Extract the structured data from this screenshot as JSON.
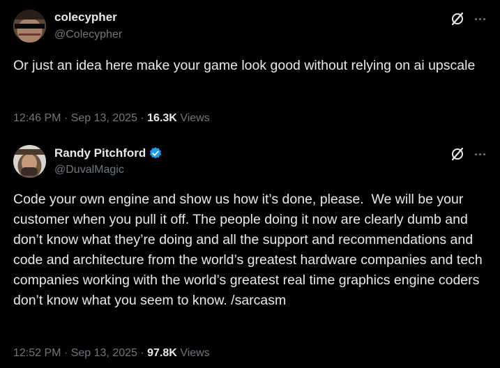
{
  "tweets": [
    {
      "author": {
        "display_name": "colecypher",
        "handle": "@Colecypher",
        "verified": false
      },
      "text": "Or just an idea here make your game look good without relying on ai upscale",
      "time": "12:46 PM",
      "date": "Sep 13, 2025",
      "separator": "·",
      "views_count": "16.3K",
      "views_label": "Views"
    },
    {
      "author": {
        "display_name": "Randy Pitchford",
        "handle": "@DuvalMagic",
        "verified": true
      },
      "text": "Code your own engine and show us how it’s done, please.  We will be your customer when you pull it off. The people doing it now are clearly dumb and don’t know what they’re doing and all the support and recommendations and code and architecture from the world’s greatest hardware companies and tech companies working with the world’s greatest real time graphics engine coders don’t know what you seem to know. /sarcasm",
      "time": "12:52 PM",
      "date": "Sep 13, 2025",
      "separator": "·",
      "views_count": "97.8K",
      "views_label": "Views"
    }
  ],
  "colors": {
    "background": "#000000",
    "primary_text": "#e7e9ea",
    "secondary_text": "#71767b",
    "verified_badge": "#1d9bf0"
  },
  "icons": [
    "grok-icon",
    "more-icon",
    "verified-badge-icon"
  ]
}
